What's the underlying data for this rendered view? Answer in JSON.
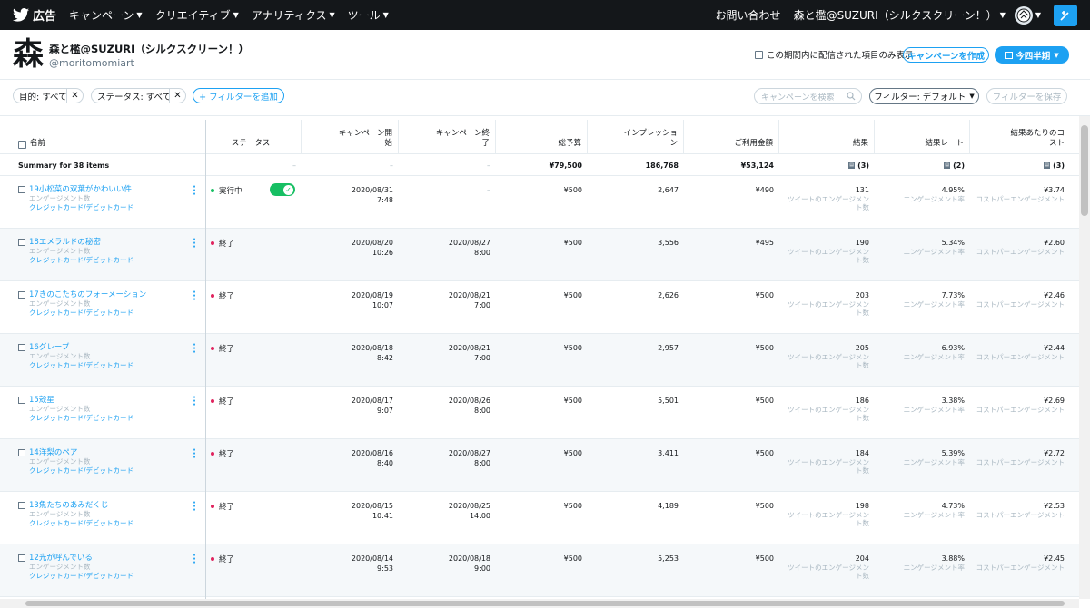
{
  "nav": {
    "brand": "広告",
    "items": [
      "キャンペーン",
      "クリエイティブ",
      "アナリティクス",
      "ツール"
    ],
    "contact": "お問い合わせ",
    "account_menu": "森と檻@SUZURI（シルクスクリーン！）"
  },
  "account": {
    "logo": "森",
    "name": "森と檻@SUZURI（シルクスクリーン！）",
    "handle": "@moritomomiart",
    "checkbox_label": "この期間内に配信された項目のみ表示",
    "create_button": "キャンペーンを作成",
    "period_button": "今四半期"
  },
  "filters": {
    "objective": "目的: すべて",
    "status": "ステータス: すべて",
    "add": "+ フィルターを追加",
    "search_placeholder": "キャンペーンを検索",
    "filter_default": "フィルター: デフォルト",
    "save": "フィルターを保存"
  },
  "table": {
    "headers": {
      "name": "名前",
      "status": "ステータス",
      "start": "キャンペーン開始",
      "end": "キャンペーン終了",
      "budget": "総予算",
      "impressions": "インプレッション",
      "spend": "ご利用金額",
      "results": "結果",
      "rate": "結果レート",
      "cost": "結果あたりのコスト"
    },
    "summary": {
      "label": "Summary for 38 items",
      "status": "–",
      "start": "–",
      "end": "–",
      "budget": "¥79,500",
      "impressions": "186,768",
      "spend": "¥53,124",
      "results": "(3)",
      "rate": "(2)",
      "cost": "(3)"
    },
    "rows": [
      {
        "name": "19小松菜の双葉がかわいい件",
        "sub1": "エンゲージメント数",
        "sub2": "クレジットカード/デビットカード",
        "status": "実行中",
        "status_color": "#17bf63",
        "start_date": "2020/08/31",
        "start_time": "7:48",
        "end_date": "–",
        "end_time": "",
        "budget": "¥500",
        "impressions": "2,647",
        "spend": "¥490",
        "results": "131",
        "results_sub": "ツイートのエンゲージメント数",
        "rate": "4.95%",
        "rate_sub": "エンゲージメント率",
        "cost": "¥3.74",
        "cost_sub": "コストパーエンゲージメント"
      },
      {
        "name": "18エメラルドの秘密",
        "sub1": "エンゲージメント数",
        "sub2": "クレジットカード/デビットカード",
        "status": "終了",
        "status_color": "#e0245e",
        "start_date": "2020/08/20",
        "start_time": "10:26",
        "end_date": "2020/08/27",
        "end_time": "8:00",
        "budget": "¥500",
        "impressions": "3,556",
        "spend": "¥495",
        "results": "190",
        "results_sub": "ツイートのエンゲージメント数",
        "rate": "5.34%",
        "rate_sub": "エンゲージメント率",
        "cost": "¥2.60",
        "cost_sub": "コストパーエンゲージメント"
      },
      {
        "name": "17きのこたちのフォーメーション",
        "sub1": "エンゲージメント数",
        "sub2": "クレジットカード/デビットカード",
        "status": "終了",
        "status_color": "#e0245e",
        "start_date": "2020/08/19",
        "start_time": "10:07",
        "end_date": "2020/08/21",
        "end_time": "7:00",
        "budget": "¥500",
        "impressions": "2,626",
        "spend": "¥500",
        "results": "203",
        "results_sub": "ツイートのエンゲージメント数",
        "rate": "7.73%",
        "rate_sub": "エンゲージメント率",
        "cost": "¥2.46",
        "cost_sub": "コストパーエンゲージメント"
      },
      {
        "name": "16グレープ",
        "sub1": "エンゲージメント数",
        "sub2": "クレジットカード/デビットカード",
        "status": "終了",
        "status_color": "#e0245e",
        "start_date": "2020/08/18",
        "start_time": "8:42",
        "end_date": "2020/08/21",
        "end_time": "7:00",
        "budget": "¥500",
        "impressions": "2,957",
        "spend": "¥500",
        "results": "205",
        "results_sub": "ツイートのエンゲージメント数",
        "rate": "6.93%",
        "rate_sub": "エンゲージメント率",
        "cost": "¥2.44",
        "cost_sub": "コストパーエンゲージメント"
      },
      {
        "name": "15殻星",
        "sub1": "エンゲージメント数",
        "sub2": "クレジットカード/デビットカード",
        "status": "終了",
        "status_color": "#e0245e",
        "start_date": "2020/08/17",
        "start_time": "9:07",
        "end_date": "2020/08/26",
        "end_time": "8:00",
        "budget": "¥500",
        "impressions": "5,501",
        "spend": "¥500",
        "results": "186",
        "results_sub": "ツイートのエンゲージメント数",
        "rate": "3.38%",
        "rate_sub": "エンゲージメント率",
        "cost": "¥2.69",
        "cost_sub": "コストパーエンゲージメント"
      },
      {
        "name": "14洋梨のペア",
        "sub1": "エンゲージメント数",
        "sub2": "クレジットカード/デビットカード",
        "status": "終了",
        "status_color": "#e0245e",
        "start_date": "2020/08/16",
        "start_time": "8:40",
        "end_date": "2020/08/27",
        "end_time": "8:00",
        "budget": "¥500",
        "impressions": "3,411",
        "spend": "¥500",
        "results": "184",
        "results_sub": "ツイートのエンゲージメント数",
        "rate": "5.39%",
        "rate_sub": "エンゲージメント率",
        "cost": "¥2.72",
        "cost_sub": "コストパーエンゲージメント"
      },
      {
        "name": "13魚たちのあみだくじ",
        "sub1": "エンゲージメント数",
        "sub2": "クレジットカード/デビットカード",
        "status": "終了",
        "status_color": "#e0245e",
        "start_date": "2020/08/15",
        "start_time": "10:41",
        "end_date": "2020/08/25",
        "end_time": "14:00",
        "budget": "¥500",
        "impressions": "4,189",
        "spend": "¥500",
        "results": "198",
        "results_sub": "ツイートのエンゲージメント数",
        "rate": "4.73%",
        "rate_sub": "エンゲージメント率",
        "cost": "¥2.53",
        "cost_sub": "コストパーエンゲージメント"
      },
      {
        "name": "12光が呼んでいる",
        "sub1": "エンゲージメント数",
        "sub2": "クレジットカード/デビットカード",
        "status": "終了",
        "status_color": "#e0245e",
        "start_date": "2020/08/14",
        "start_time": "9:53",
        "end_date": "2020/08/18",
        "end_time": "9:00",
        "budget": "¥500",
        "impressions": "5,253",
        "spend": "¥500",
        "results": "204",
        "results_sub": "ツイートのエンゲージメント数",
        "rate": "3.88%",
        "rate_sub": "エンゲージメント率",
        "cost": "¥2.45",
        "cost_sub": "コストパーエンゲージメント"
      }
    ]
  },
  "colors": {
    "accent": "#1da1f2",
    "nav_bg": "#14171a",
    "active": "#17bf63",
    "ended": "#e0245e"
  }
}
